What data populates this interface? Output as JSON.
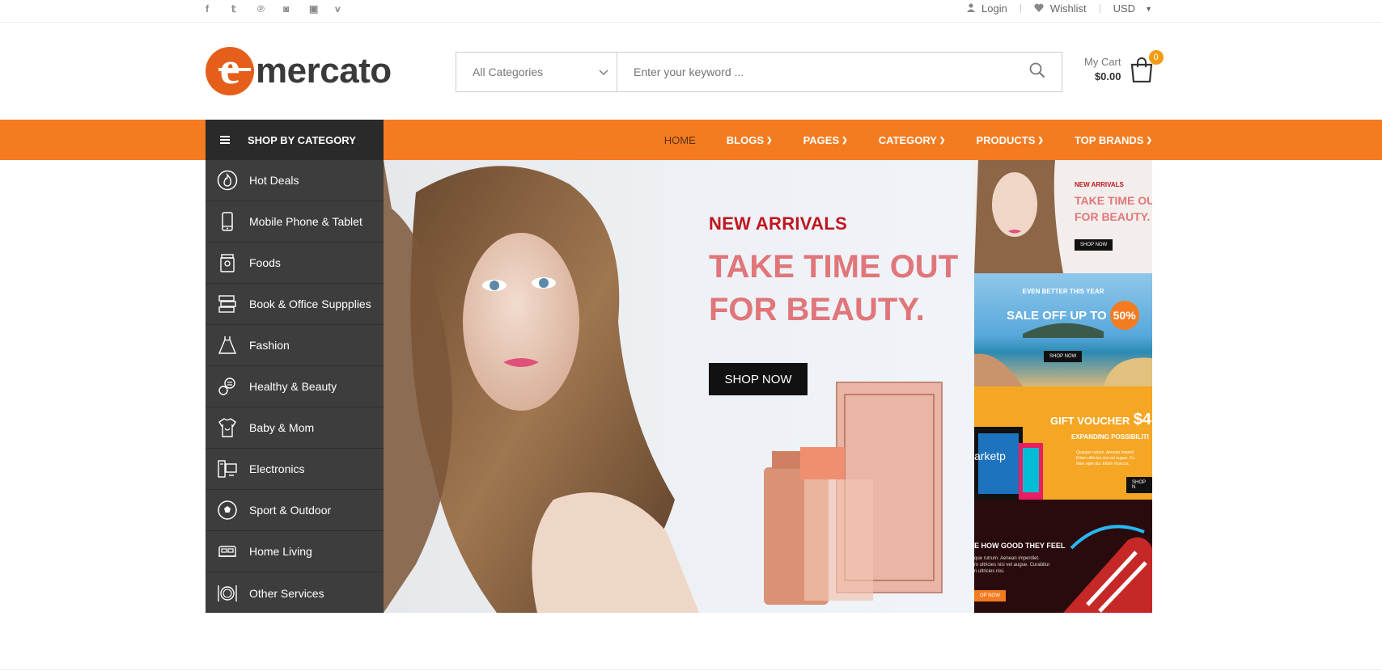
{
  "topbar": {
    "social": [
      {
        "icon": "facebook-icon",
        "glyph": "f"
      },
      {
        "icon": "twitter-icon",
        "glyph": "𝕥"
      },
      {
        "icon": "pinterest-icon",
        "glyph": "℗"
      },
      {
        "icon": "instagram-icon",
        "glyph": "◙"
      },
      {
        "icon": "youtube-icon",
        "glyph": "▣"
      },
      {
        "icon": "vimeo-icon",
        "glyph": "v"
      }
    ],
    "login": "Login",
    "wishlist": "Wishlist",
    "currency": "USD"
  },
  "header": {
    "logo_letter": "e",
    "logo_text": "mercato",
    "category_select": "All Categories",
    "search_placeholder": "Enter your keyword ...",
    "cart_label": "My Cart",
    "cart_amount": "$0.00",
    "cart_count": "0"
  },
  "nav": {
    "shop_by_category": "SHOP BY CATEGORY",
    "items": [
      {
        "label": "HOME",
        "active": true
      },
      {
        "label": "BLOGS",
        "chevron": "⌄"
      },
      {
        "label": "PAGES",
        "chevron": "⌄"
      },
      {
        "label": "CATEGORY",
        "chevron": "⌄"
      },
      {
        "label": "PRODUCTS",
        "chevron": "⌄"
      },
      {
        "label": "TOP BRANDS",
        "chevron": "⌄"
      }
    ]
  },
  "sidebar": {
    "items": [
      {
        "label": "Hot Deals",
        "icon": "flame-icon"
      },
      {
        "label": "Mobile Phone & Tablet",
        "icon": "phone-icon"
      },
      {
        "label": "Foods",
        "icon": "food-jar-icon"
      },
      {
        "label": "Book & Office Suppplies",
        "icon": "books-icon"
      },
      {
        "label": "Fashion",
        "icon": "dress-icon"
      },
      {
        "label": "Healthy & Beauty",
        "icon": "beauty-icon"
      },
      {
        "label": "Baby & Mom",
        "icon": "baby-icon"
      },
      {
        "label": "Electronics",
        "icon": "computer-icon"
      },
      {
        "label": "Sport & Outdoor",
        "icon": "ball-icon"
      },
      {
        "label": "Home Living",
        "icon": "sofa-icon"
      },
      {
        "label": "Other Services",
        "icon": "cutlery-icon"
      }
    ]
  },
  "hero": {
    "kicker": "NEW ARRIVALS",
    "line1": "TAKE TIME OUT",
    "line2": "FOR BEAUTY.",
    "button": "SHOP NOW"
  },
  "banners": {
    "b1": {
      "kicker": "NEW ARRIVALS",
      "line1": "TAKE TIME OU",
      "line2": "FOR BEAUTY.",
      "button": "SHOP NOW"
    },
    "b2": {
      "kicker": "EVEN BETTER THIS YEAR",
      "line": "SALE OFF UP TO",
      "pct": "50%",
      "button": "SHOP NOW"
    },
    "b3": {
      "line1": "GIFT VOUCHER",
      "amount": "$4",
      "line2": "EXPANDING POSSIBILITI",
      "body1": "Quisque rutrum. Aenean imperd",
      "body2": "Etiam ultricies nisi vel augue. Cu",
      "body3": "Nam eget dui. Etiam rhoncus.",
      "brand": "arketp",
      "button": "SHOP N"
    },
    "b4": {
      "title": "E HOW GOOD THEY FEEL",
      "body1": "que rutrum. Aenean imperdiet.",
      "body2": "m ultricies nisi vel augue. Curabitur",
      "body3": "n ultricies nisi.",
      "button": "OP NOW"
    }
  },
  "colors": {
    "accent": "#f47b20",
    "dark": "#2a2a2a",
    "sidebar": "#3d3d3d",
    "hero_red": "#c0161f",
    "hero_pink": "#e0767a"
  }
}
